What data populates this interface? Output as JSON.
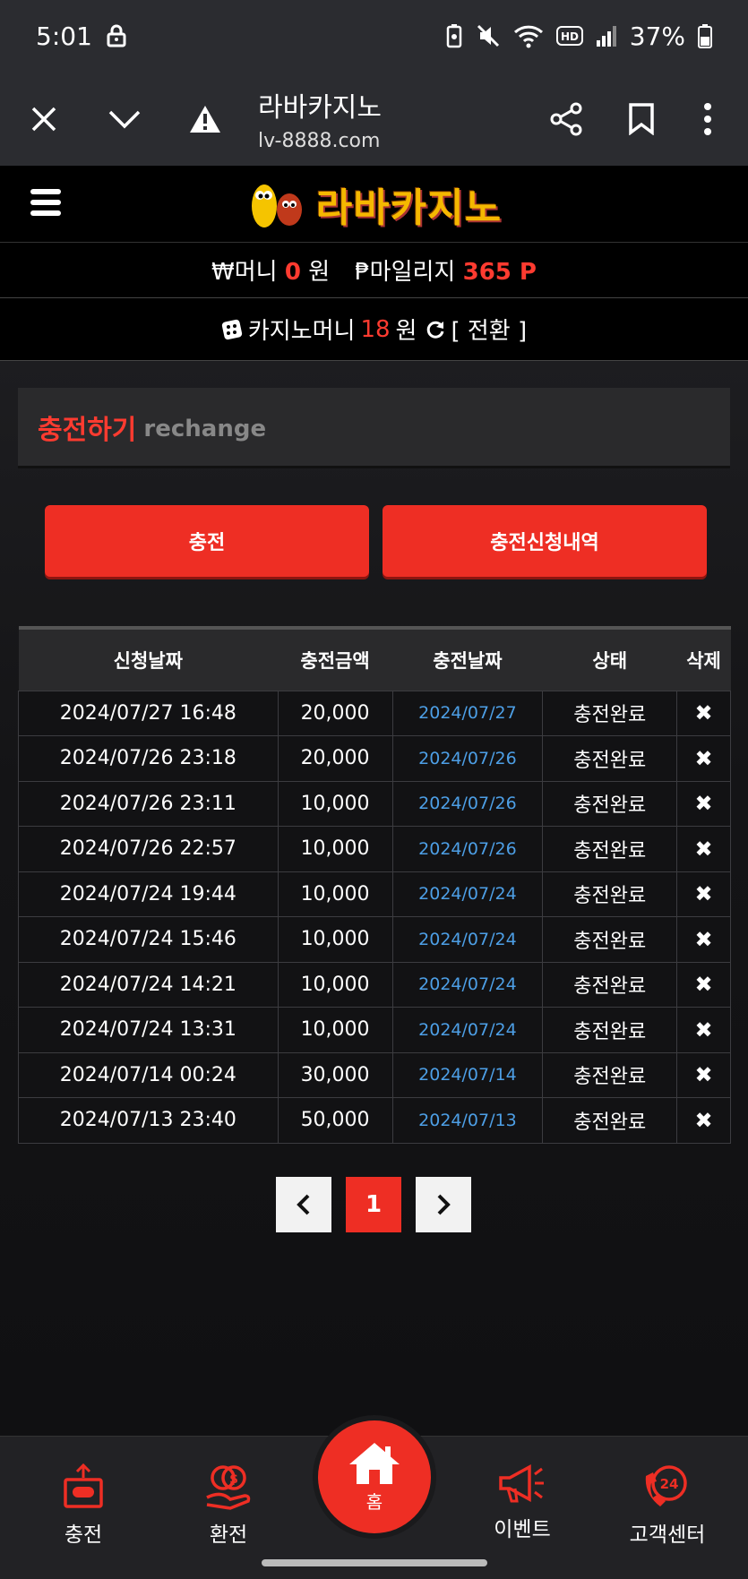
{
  "status_bar": {
    "time": "5:01",
    "battery": "37%",
    "icons": [
      "lock-icon",
      "battery-saver-icon",
      "mute-icon",
      "wifi-icon",
      "hd-icon",
      "signal-icon",
      "battery-icon"
    ]
  },
  "browser": {
    "page_title": "라바카지노",
    "host": "lv-8888.com",
    "icons": [
      "close-icon",
      "chevron-down-icon",
      "warning-icon",
      "share-icon",
      "bookmark-icon",
      "more-icon"
    ]
  },
  "site": {
    "logo_text": "라바카지노",
    "money_label": "₩머니",
    "money_value": "0",
    "money_unit": "원",
    "mileage_label": "₱마일리지",
    "mileage_value": "365 P",
    "casino_label": "카지노머니",
    "casino_value": "18",
    "casino_unit": "원",
    "switch_label": "[ 전환 ]"
  },
  "section": {
    "title_ko": "충전하기",
    "title_en": "rechange"
  },
  "buttons": {
    "recharge": "충전",
    "history": "충전신청내역"
  },
  "table": {
    "headers": [
      "신청날짜",
      "충전금액",
      "충전날짜",
      "상태",
      "삭제"
    ],
    "rows": [
      [
        "2024/07/27 16:48",
        "20,000",
        "2024/07/27",
        "충전완료",
        "✖"
      ],
      [
        "2024/07/26 23:18",
        "20,000",
        "2024/07/26",
        "충전완료",
        "✖"
      ],
      [
        "2024/07/26 23:11",
        "10,000",
        "2024/07/26",
        "충전완료",
        "✖"
      ],
      [
        "2024/07/26 22:57",
        "10,000",
        "2024/07/26",
        "충전완료",
        "✖"
      ],
      [
        "2024/07/24 19:44",
        "10,000",
        "2024/07/24",
        "충전완료",
        "✖"
      ],
      [
        "2024/07/24 15:46",
        "10,000",
        "2024/07/24",
        "충전완료",
        "✖"
      ],
      [
        "2024/07/24 14:21",
        "10,000",
        "2024/07/24",
        "충전완료",
        "✖"
      ],
      [
        "2024/07/24 13:31",
        "10,000",
        "2024/07/24",
        "충전완료",
        "✖"
      ],
      [
        "2024/07/14 00:24",
        "30,000",
        "2024/07/14",
        "충전완료",
        "✖"
      ],
      [
        "2024/07/13 23:40",
        "50,000",
        "2024/07/13",
        "충전완료",
        "✖"
      ]
    ]
  },
  "pager": {
    "prev": "‹",
    "current": "1",
    "next": "›"
  },
  "bottom_nav": {
    "recharge": "충전",
    "exchange": "환전",
    "home": "홈",
    "event": "이벤트",
    "support": "고객센터"
  },
  "colors": {
    "accent": "#ee2e24",
    "link_blue": "#4d9fe6",
    "gold": "#f5b800"
  }
}
